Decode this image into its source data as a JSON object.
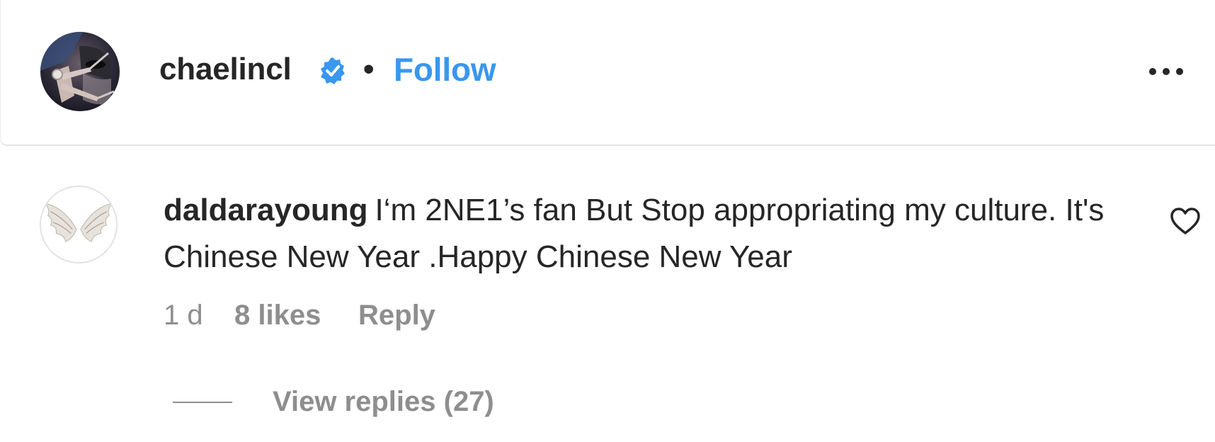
{
  "post_header": {
    "username": "chaelincl",
    "verified_icon": "verified-badge-icon",
    "separator": "•",
    "follow_label": "Follow",
    "more_icon": "more-options-icon",
    "avatar_icon": "profile-photo",
    "colors": {
      "follow": "#3897f0",
      "verified": "#3897f0",
      "text": "#262626"
    }
  },
  "comment": {
    "avatar_icon": "angel-wings-avatar",
    "username": "daldarayoung",
    "text": "I‘m 2NE1’s fan But Stop appropriating my culture. It's Chinese New Year .Happy Chinese New Year",
    "like_icon": "heart-outline-icon",
    "time": "1 d",
    "likes": "8 likes",
    "reply_label": "Reply",
    "view_replies": "View replies (27)",
    "colors": {
      "meta": "#8e8e8e"
    }
  }
}
